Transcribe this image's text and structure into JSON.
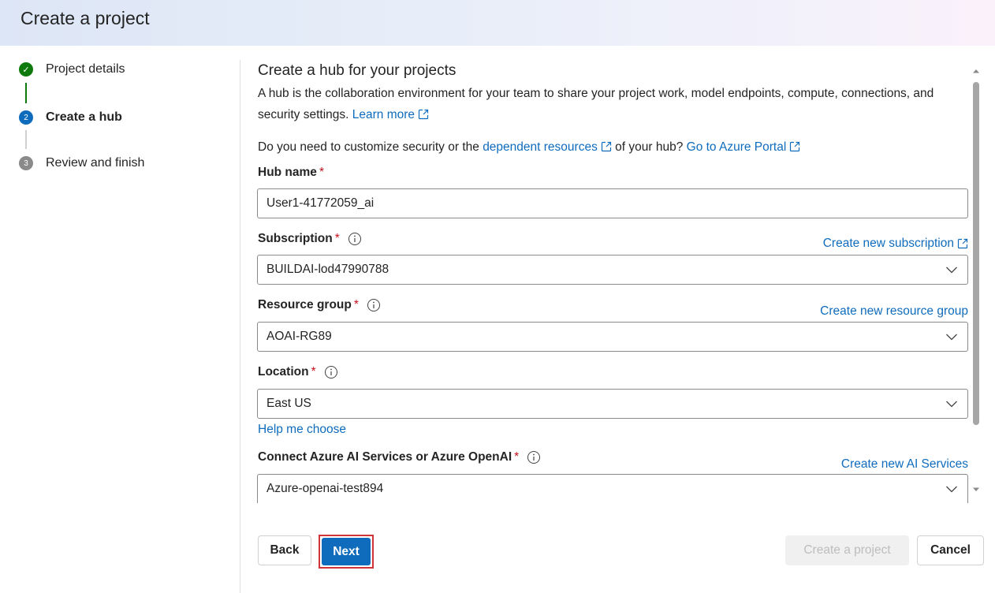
{
  "header": {
    "title": "Create a project"
  },
  "stepper": {
    "steps": [
      {
        "label": "Project details",
        "marker": "✓",
        "state": "complete"
      },
      {
        "label": "Create a hub",
        "marker": "2",
        "state": "active"
      },
      {
        "label": "Review and finish",
        "marker": "3",
        "state": "upcoming"
      }
    ]
  },
  "section": {
    "title": "Create a hub for your projects",
    "description": "A hub is the collaboration environment for your team to share your project work, model endpoints, compute, connections, and security settings.",
    "learn_more": "Learn more",
    "customize_prefix": "Do you need to customize security or the",
    "dependent_resources": "dependent resources",
    "customize_middle": "of your hub?",
    "go_to_portal": "Go to Azure Portal"
  },
  "fields": {
    "hub_name": {
      "label": "Hub name",
      "required": "*",
      "value": "User1-41772059_ai"
    },
    "subscription": {
      "label": "Subscription",
      "required": "*",
      "value": "BUILDAI-lod47990788",
      "link": "Create new subscription"
    },
    "resource_group": {
      "label": "Resource group",
      "required": "*",
      "value": "AOAI-RG89",
      "link": "Create new resource group"
    },
    "location": {
      "label": "Location",
      "required": "*",
      "value": "East US",
      "help": "Help me choose"
    },
    "ai_services": {
      "label": "Connect Azure AI Services or Azure OpenAI",
      "required": "*",
      "value": "Azure-openai-test894",
      "link": "Create new AI Services"
    }
  },
  "footer": {
    "back": "Back",
    "next": "Next",
    "create": "Create a project",
    "cancel": "Cancel"
  },
  "colors": {
    "accent": "#0f6cbd",
    "success": "#0e7a0d",
    "required": "#c50f1f",
    "highlight": "#d13438"
  }
}
